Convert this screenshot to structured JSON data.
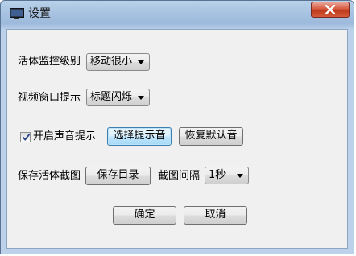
{
  "window": {
    "title": "设置",
    "icon": "monitor-icon",
    "close_icon": "close-icon"
  },
  "monitor_level": {
    "label": "活体监控级别",
    "selected": "移动很小"
  },
  "video_hint": {
    "label": "视频窗口提示",
    "selected": "标题闪烁"
  },
  "sound": {
    "checkbox_label": "开启声音提示",
    "checked": true,
    "choose_button": "选择提示音",
    "restore_button": "恢复默认音"
  },
  "capture": {
    "label": "保存活体截图",
    "save_dir_button": "保存目录",
    "interval_label": "截图间隔",
    "interval_selected": "1秒"
  },
  "footer": {
    "ok_button": "确定",
    "cancel_button": "取消"
  },
  "colors": {
    "titlebar": "#a9c4e2",
    "client_bg": "#f0f0f0",
    "close_button": "#c0391d",
    "focused_button_border": "#3c7fb1"
  }
}
